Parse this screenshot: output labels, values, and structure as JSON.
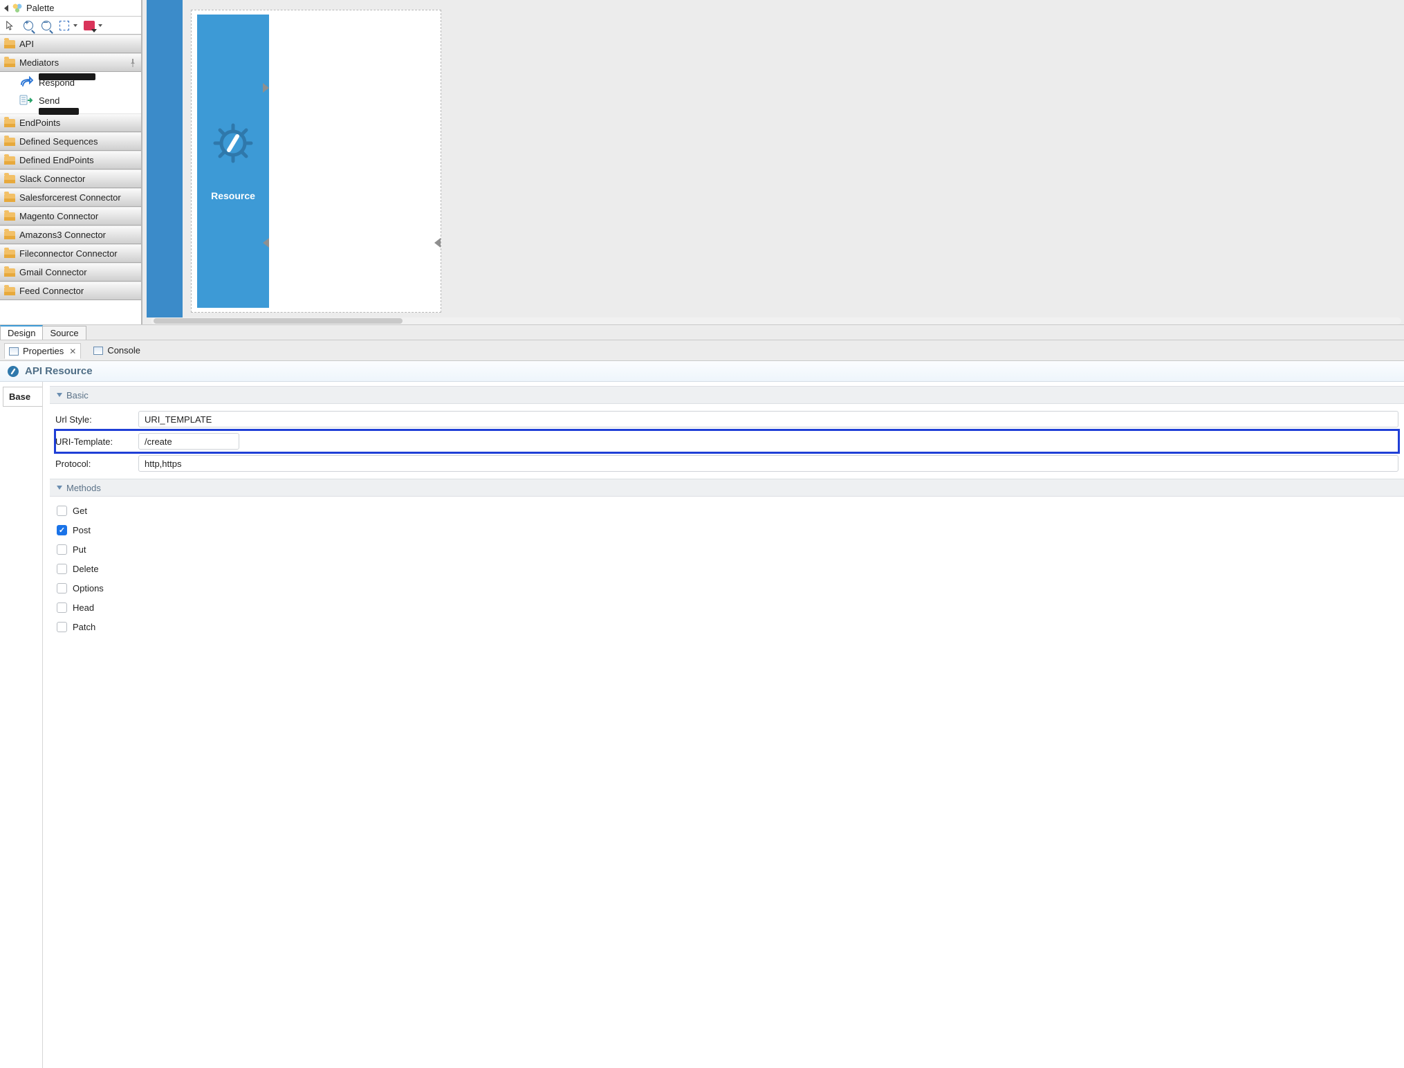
{
  "palette": {
    "title": "Palette",
    "drawers": [
      {
        "label": "API",
        "open": false
      },
      {
        "label": "Mediators",
        "open": true,
        "pinned": true,
        "items": [
          {
            "name": "Respond",
            "kind": "respond"
          },
          {
            "name": "Send",
            "kind": "send"
          }
        ]
      },
      {
        "label": "EndPoints"
      },
      {
        "label": "Defined Sequences"
      },
      {
        "label": "Defined EndPoints"
      },
      {
        "label": "Slack Connector"
      },
      {
        "label": "Salesforcerest Connector"
      },
      {
        "label": "Magento Connector"
      },
      {
        "label": "Amazons3 Connector"
      },
      {
        "label": "Fileconnector Connector"
      },
      {
        "label": "Gmail Connector"
      },
      {
        "label": "Feed Connector"
      }
    ]
  },
  "canvas": {
    "resource_label": "Resource"
  },
  "editor_tabs": {
    "design": "Design",
    "source": "Source",
    "active": "Design"
  },
  "view_tabs": {
    "properties": "Properties",
    "console": "Console",
    "active": "Properties"
  },
  "properties": {
    "title": "API Resource",
    "side_tab": "Base",
    "basic": {
      "header": "Basic",
      "url_style_label": "Url Style:",
      "url_style": "URI_TEMPLATE",
      "uri_template_label": "URI-Template:",
      "uri_template": "/create",
      "protocol_label": "Protocol:",
      "protocol": "http,https"
    },
    "methods": {
      "header": "Methods",
      "items": [
        {
          "label": "Get",
          "checked": false
        },
        {
          "label": "Post",
          "checked": true
        },
        {
          "label": "Put",
          "checked": false
        },
        {
          "label": "Delete",
          "checked": false
        },
        {
          "label": "Options",
          "checked": false
        },
        {
          "label": "Head",
          "checked": false
        },
        {
          "label": "Patch",
          "checked": false
        }
      ]
    }
  }
}
